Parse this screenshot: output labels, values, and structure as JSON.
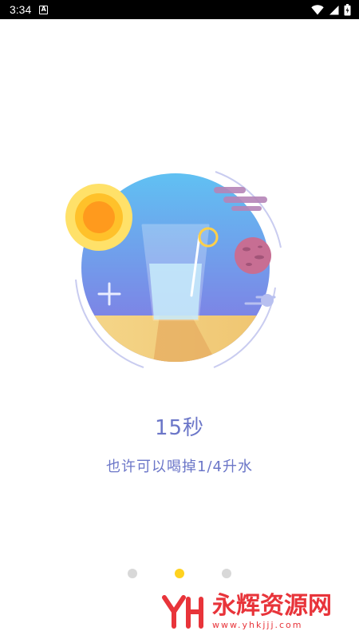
{
  "status_bar": {
    "time": "3:34",
    "notification_icon": "a-notification-icon",
    "icons": [
      "wifi-icon",
      "signal-icon",
      "battery-icon"
    ]
  },
  "illustration": {
    "icons": [
      "sun-icon",
      "glass-icon",
      "planet-icon",
      "cloud-icon",
      "plus-icon"
    ]
  },
  "content": {
    "timer": "15秒",
    "description": "也许可以喝掉1/4升水"
  },
  "pager": {
    "count": 3,
    "active_index": 1,
    "active_color": "#FFD21F",
    "inactive_color": "#D8D8D8"
  },
  "watermark": {
    "name": "永辉资源网",
    "url": "www.yhkjjj.com"
  },
  "colors": {
    "text_accent": "#6B76C8",
    "watermark": "#E8343A"
  }
}
